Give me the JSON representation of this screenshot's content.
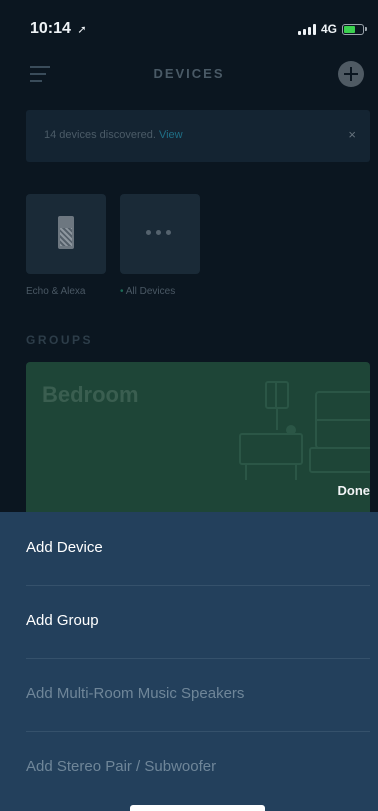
{
  "status_bar": {
    "time": "10:14",
    "location_icon": "location-arrow-icon",
    "network": "4G",
    "battery_icon": "battery-charging-icon",
    "battery_level": 0.55,
    "battery_color": "#3bd14f"
  },
  "header": {
    "title": "DEVICES",
    "menu_icon": "hamburger-icon",
    "add_icon": "plus-circle-icon"
  },
  "banner": {
    "message": "14 devices discovered. ",
    "link": "View",
    "close": "×"
  },
  "tiles": [
    {
      "label": "Echo & Alexa",
      "icon": "echo-speaker-icon"
    },
    {
      "label": "All Devices",
      "bullet": "•",
      "icon": "more-dots-icon"
    }
  ],
  "groups": {
    "heading": "GROUPS",
    "items": [
      {
        "name": "Bedroom"
      }
    ]
  },
  "done_label": "Done",
  "action_sheet": {
    "items": [
      {
        "label": "Add Device",
        "enabled": true
      },
      {
        "label": "Add Group",
        "enabled": true
      },
      {
        "label": "Add Multi-Room Music Speakers",
        "enabled": false
      },
      {
        "label": "Add Stereo Pair / Subwoofer",
        "enabled": false
      }
    ]
  },
  "colors": {
    "background": "#0b1620",
    "sheet": "#23405c",
    "group_card": "#1e4537",
    "link": "#1f6f86"
  }
}
